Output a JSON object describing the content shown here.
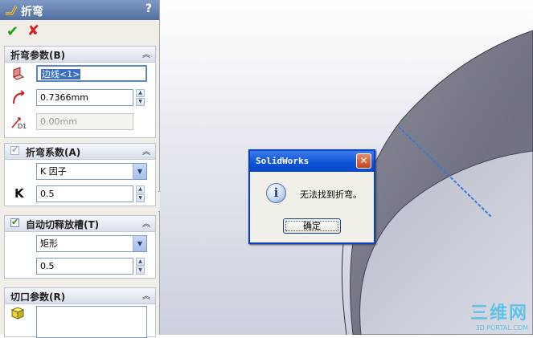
{
  "panel": {
    "title": "折弯",
    "help": "?",
    "ok_glyph": "✔",
    "cancel_glyph": "✘",
    "bend_params": {
      "header": "折弯参数(B)",
      "edge_value": "边线<1>",
      "radius_value": "0.7366mm",
      "depth_value": "0.00mm"
    },
    "bend_allowance": {
      "header": "折弯系数(A)",
      "checked": true,
      "type_selected": "K 因子",
      "k_label": "K",
      "k_value": "0.5"
    },
    "auto_relief": {
      "header": "自动切释放槽(T)",
      "checked": true,
      "type_selected": "矩形",
      "ratio_value": "0.5"
    },
    "cut_params": {
      "header": "切口参数(R)"
    }
  },
  "dialog": {
    "title": "SolidWorks",
    "message": "无法找到折弯。",
    "ok_label": "确定",
    "close_glyph": "✕",
    "icon": "information-icon"
  },
  "watermark": {
    "line1": "三维网",
    "line2": "3D PORTAL.COM"
  },
  "colors": {
    "title_bar": "#536f9f",
    "dialog_title": "#0b53d6",
    "accept": "#19a31b",
    "reject": "#d81f1f",
    "watermark": "#5fc3e8",
    "edge_highlight": "#3b78d6"
  }
}
